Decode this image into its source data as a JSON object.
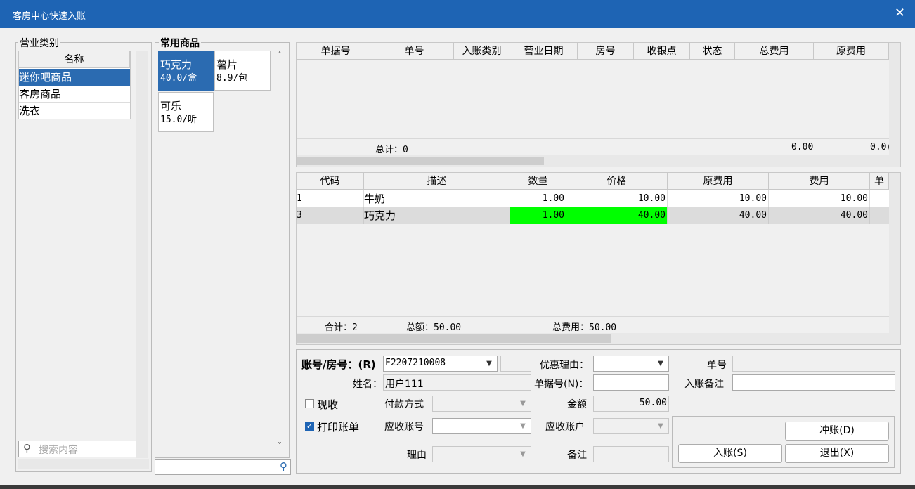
{
  "window": {
    "title": "客房中心快速入账",
    "close_glyph": "✕"
  },
  "category_panel": {
    "title": "营业类别",
    "column_header": "名称",
    "items": [
      "迷你吧商品",
      "客房商品",
      "洗衣"
    ],
    "selected_index": 0,
    "search_placeholder": "搜索内容"
  },
  "products_panel": {
    "title": "常用商品",
    "items": [
      {
        "name": "巧克力",
        "price": "40.0/盒",
        "selected": true
      },
      {
        "name": "薯片",
        "price": "8.9/包",
        "selected": false
      },
      {
        "name": "可乐",
        "price": "15.0/听",
        "selected": false
      }
    ],
    "search_placeholder": ""
  },
  "bills_table": {
    "headers": [
      "单据号",
      "单号",
      "入账类别",
      "营业日期",
      "房号",
      "收银点",
      "状态",
      "总费用",
      "原费用"
    ],
    "footer": {
      "total_label": "总计：0",
      "total_fee": "0.00",
      "orig_fee": "0.0("
    }
  },
  "items_table": {
    "headers": [
      "代码",
      "描述",
      "数量",
      "价格",
      "原费用",
      "费用",
      "单"
    ],
    "rows": [
      {
        "code": "1",
        "desc": "牛奶",
        "qty": "1.00",
        "price": "10.00",
        "orig_fee": "10.00",
        "fee": "10.00"
      },
      {
        "code": "3",
        "desc": "巧克力",
        "qty": "1.00",
        "price": "40.00",
        "orig_fee": "40.00",
        "fee": "40.00"
      }
    ],
    "footer": {
      "count": "合计：2",
      "amount": "总额：50.00",
      "total": "总费用：50.00"
    },
    "highlight_color": "#00ff00"
  },
  "form": {
    "account_label": "账号/房号：(R)",
    "account_value": "F2207210008",
    "discount_label": "优惠理由：",
    "bill_no_label": "单号",
    "name_label": "姓名：",
    "name_value": "用户111",
    "doc_no_label": "单据号(N)：",
    "remark_label": "入账备注",
    "cash_label": "现收",
    "cash_checked": false,
    "payment_label": "付款方式",
    "amount_label": "金额",
    "amount_value": "50.00",
    "print_label": "打印账单",
    "print_checked": true,
    "receivable_no_label": "应收账号",
    "receivable_acct_label": "应收账户",
    "reason_label": "理由",
    "note_label": "备注"
  },
  "buttons": {
    "reverse": "冲账(D)",
    "post": "入账(S)",
    "exit": "退出(X)"
  },
  "colors": {
    "titlebar": "#1e64b4",
    "selection": "#2b6bb1",
    "highlight": "#00ff00"
  }
}
